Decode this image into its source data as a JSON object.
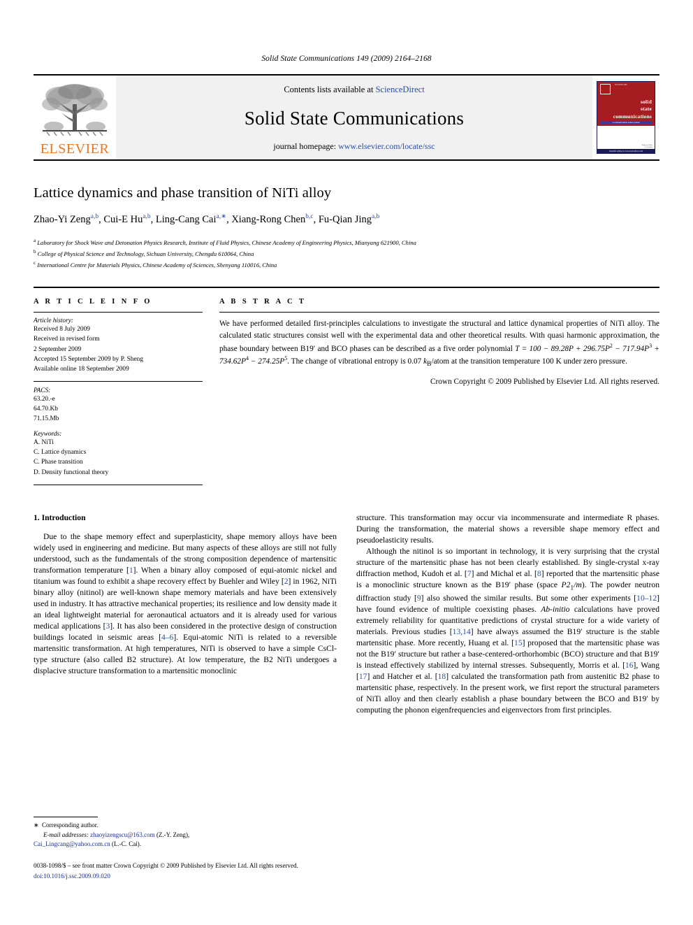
{
  "running_head": "Solid State Communications 149 (2009) 2164–2168",
  "masthead": {
    "publisher_wordmark": "ELSEVIER",
    "contents_prefix": "Contents lists available at ",
    "contents_link": "ScienceDirect",
    "journal_title": "Solid State Communications",
    "homepage_prefix": "journal homepage: ",
    "homepage_url": "www.elsevier.com/locate/ssc",
    "cover": {
      "line1": "solid",
      "line2": "state",
      "line3": "communications",
      "tagline": "a condensed matter science journal",
      "footer_bar": "Available online at www.sciencedirect.com",
      "foot_note_1": "Editor-in-Chief",
      "foot_note_2": "A. Fasolino"
    },
    "accent_orange": "#E87722",
    "link_blue": "#2a4ea2",
    "cover_red": "#a51c21"
  },
  "article": {
    "title": "Lattice dynamics and phase transition of NiTi alloy",
    "authors": [
      {
        "name": "Zhao-Yi Zeng",
        "sup": "a,b",
        "sep": ", "
      },
      {
        "name": "Cui-E Hu",
        "sup": "a,b",
        "sep": ", "
      },
      {
        "name": "Ling-Cang Cai",
        "sup": "a,∗",
        "sep": ", "
      },
      {
        "name": "Xiang-Rong Chen",
        "sup": "b,c",
        "sep": ", "
      },
      {
        "name": "Fu-Qian Jing",
        "sup": "a,b",
        "sep": ""
      }
    ],
    "affiliations": [
      {
        "mark": "a",
        "text": "Laboratory for Shock Wave and Detonation Physics Research, Institute of Fluid Physics, Chinese Academy of Engineering Physics, Mianyang 621900, China"
      },
      {
        "mark": "b",
        "text": "College of Physical Science and Technology, Sichuan University, Chengdu 610064, China"
      },
      {
        "mark": "c",
        "text": "International Centre for Materials Physics, Chinese Academy of Sciences, Shenyang 110016, China"
      }
    ]
  },
  "info": {
    "heading": "A R T I C L E    I N F O",
    "history_label": "Article history:",
    "history": [
      "Received 8 July 2009",
      "Received in revised form",
      "2 September 2009",
      "Accepted 15 September 2009 by P. Sheng",
      "Available online 18 September 2009"
    ],
    "pacs_label": "PACS:",
    "pacs": [
      "63.20.-e",
      "64.70.Kb",
      "71.15.Mb"
    ],
    "keywords_label": "Keywords:",
    "keywords": [
      "A. NiTi",
      "C. Lattice dynamics",
      "C. Phase transition",
      "D. Density functional theory"
    ]
  },
  "abstract": {
    "heading": "A B S T R A C T",
    "part1": "We have performed detailed first-principles calculations to investigate the structural and lattice dynamical properties of NiTi alloy. The calculated static structures consist well with the experimental data and other theoretical results. With quasi harmonic approximation, the phase boundary between B19",
    "prime1": "′",
    "part2": " and BCO phases can be described as a five order polynomial ",
    "formula": "T = 100 − 89.28P + 296.75P",
    "exp2": "2",
    "formula_b": " − 717.94P",
    "exp3": "3",
    "formula_c": " + 734.62P",
    "exp4": "4",
    "formula_d": " − 274.25P",
    "exp5": "5",
    "part3": ". The change of vibrational entropy is 0.07 ",
    "kb": "k",
    "kb_sub": "B",
    "part4": "/atom at the transition temperature 100 K under zero pressure.",
    "copyright": "Crown Copyright © 2009 Published by Elsevier Ltd. All rights reserved."
  },
  "body": {
    "section_heading": "1. Introduction",
    "left_paragraph": {
      "t1": "Due to the shape memory effect and superplasticity, shape memory alloys have been widely used in engineering and medicine. But many aspects of these alloys are still not fully understood, such as the fundamentals of the strong composition dependence of martensitic transformation temperature [",
      "c1": "1",
      "t2": "]. When a binary alloy composed of equi-atomic nickel and titanium was found to exhibit a shape recovery effect by Buehler and Wiley [",
      "c2": "2",
      "t3": "] in 1962, NiTi binary alloy (nitinol) are well-known shape memory materials and have been extensively used in industry. It has attractive mechanical properties; its resilience and low density made it an ideal lightweight material for aeronautical actuators and it is already used for various medical applications [",
      "c3": "3",
      "t4": "]. It has also been considered in the protective design of construction buildings located in seismic areas [",
      "c4": "4–6",
      "t5": "]. Equi-atomic NiTi is related to a reversible martensitic transformation. At high temperatures, NiTi is observed to have a simple CsCl-type structure (also called B2 structure). At low temperature, the B2 NiTi undergoes a displacive structure transformation to a martensitic monoclinic"
    },
    "right_paragraph_1": "structure. This transformation may occur via incommensurate and intermediate R phases. During the transformation, the material shows a reversible shape memory effect and pseudoelasticity results.",
    "right_paragraph_2": {
      "t1": "Although the nitinol is so important in technology, it is very surprising that the crystal structure of the martensitic phase has not been clearly established. By single-crystal x-ray diffraction method, Kudoh et al. [",
      "c1": "7",
      "t2": "] and Michal et al. [",
      "c2": "8",
      "t3": "] reported that the martensitic phase is a monoclinic structure known as the B19′ phase (space ",
      "space_group": "P2",
      "space_group_sub": "1",
      "space_group_rest": "/m",
      "t4": "). The powder neutron diffraction study [",
      "c3": "9",
      "t5": "] also showed the similar results. But some other experiments [",
      "c4": "10–12",
      "t6": "] have found evidence of multiple coexisting phases. ",
      "ital1": "Ab-initio",
      "t7": " calculations have proved extremely reliability for quantitative predictions of crystal structure for a wide variety of materials. Previous studies [",
      "c5": "13,14",
      "t8": "] have always assumed the B19′ structure is the stable martensitic phase. More recently, Huang et al. [",
      "c6": "15",
      "t9": "] proposed that the  martensitic phase was not the B19′ structure but rather a base-centered-orthorhombic (BCO) structure and that B19′ is instead effectively stabilized by internal stresses. Subsequently, Morris et al. [",
      "c7": "16",
      "t10": "], Wang [",
      "c8": "17",
      "t11": "] and Hatcher et al. [",
      "c9": "18",
      "t12": "] calculated the transformation path from austenitic B2 phase to martensitic phase, respectively. In the present work, we first report the structural parameters of NiTi alloy and then clearly establish a phase boundary between the BCO and B19′ by computing the phonon eigenfrequencies and eigenvectors from first principles."
    }
  },
  "footnote": {
    "star": "∗",
    "corresponding": "Corresponding author.",
    "email_label": "E-mail addresses:",
    "email1": "zhaoyizengscu@163.com",
    "email1_who": " (Z.-Y. Zeng),",
    "email2": "Cai_Lingcang@yahoo.com.cn",
    "email2_who": " (L.-C. Cai)."
  },
  "footer": {
    "issn_line": "0038-1098/$ – see front matter Crown Copyright © 2009 Published by Elsevier Ltd. All rights reserved.",
    "doi": "doi:10.1016/j.ssc.2009.09.020"
  }
}
